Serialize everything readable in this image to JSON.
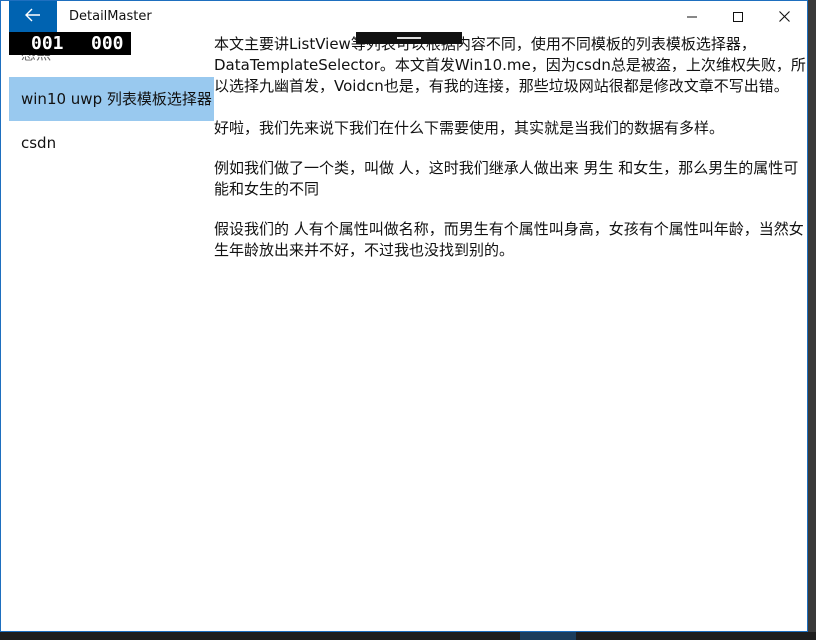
{
  "window": {
    "title": "DetailMaster"
  },
  "debug": {
    "counter_left": "001",
    "counter_right": "000"
  },
  "master": {
    "items": [
      {
        "label": "感熙"
      },
      {
        "label": "win10 uwp 列表模板选择器"
      },
      {
        "label": "csdn"
      }
    ],
    "selected_index": 1
  },
  "detail": {
    "paragraphs": [
      "本文主要讲ListView等列表可以根据内容不同，使用不同模板的列表模板选择器，DataTemplateSelector。本文首发Win10.me，因为csdn总是被盗，上次维权失败，所以选择九幽首发，Voidcn也是，有我的连接，那些垃圾网站很都是修改文章不写出错。",
      "好啦，我们先来说下我们在什么下需要使用，其实就是当我们的数据有多样。",
      "例如我们做了一个类，叫做 人，这时我们继承人做出来 男生 和女生，那么男生的属性可能和女生的不同",
      "假设我们的 人有个属性叫做名称，而男生有个属性叫身高，女孩有个属性叫年龄，当然女生年龄放出来并不好，不过我也没找到别的。"
    ]
  },
  "colors": {
    "accent": "#0063b1",
    "selection": "#99c9ef",
    "border": "#1e6fbf"
  },
  "icons": {
    "back": "back-arrow-icon",
    "minimize": "minimize-icon",
    "maximize": "maximize-icon",
    "close": "close-icon"
  }
}
